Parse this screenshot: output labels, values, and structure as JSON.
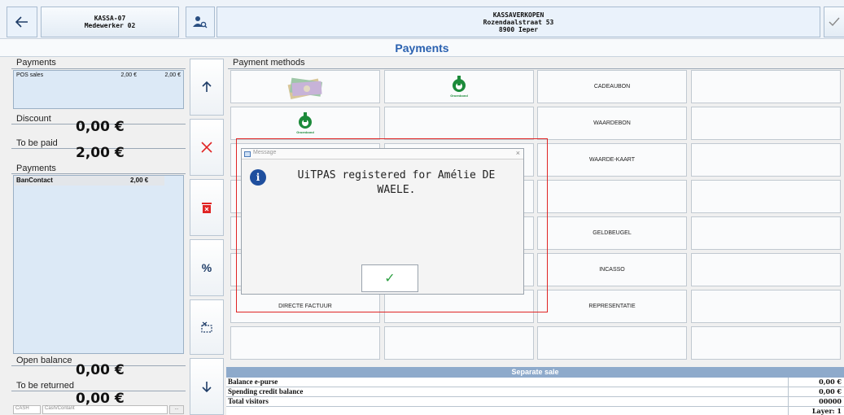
{
  "header": {
    "register": "KASSA-07",
    "employee": "Medewerker 02",
    "shop_name": "KASSAVERKOPEN",
    "shop_street": "Rozendaalstraat 53",
    "shop_city": "8900 Ieper"
  },
  "title": "Payments",
  "left": {
    "payments_label": "Payments",
    "pos_sales_label": "POS sales",
    "pos_sales_v1": "2,00 €",
    "pos_sales_v2": "2,00 €",
    "discount_label": "Discount",
    "discount_value": "0,00 €",
    "to_be_paid_label": "To be paid",
    "to_be_paid_value": "2,00 €",
    "payments2_label": "Payments",
    "bancontact_label": "BanContact",
    "bancontact_value": "2,00 €",
    "open_balance_label": "Open balance",
    "open_balance_value": "0,00 €",
    "to_be_returned_label": "To be returned",
    "to_be_returned_value": "0,00 €",
    "cash_label": "CASH",
    "cash_field": "Cash/Contant",
    "more_btn": "..."
  },
  "payment_methods_label": "Payment methods",
  "grid": {
    "cadeaubon": "CADEAUBON",
    "waardebon": "WAARDEBON",
    "waardekaart": "WAARDE-KAART",
    "geldbeugel": "GELDBEUGEL",
    "incasso": "INCASSO",
    "directe_factuur": "DIRECTE FACTUUR",
    "representatie": "REPRESENTATIE",
    "groenbond_1": "Groenbond",
    "groenbond_2": "Groenbond"
  },
  "dialog": {
    "title": "Message",
    "close": "×",
    "message_line1": "UiTPAS registered for Amélie DE",
    "message_line2": "WAELE.",
    "info_glyph": "i",
    "ok_glyph": "✓"
  },
  "bottom": {
    "header": "Separate sale",
    "rows": [
      {
        "label": "Balance e-purse",
        "value": "0,00 €"
      },
      {
        "label": "Spending credit balance",
        "value": "0,00 €"
      },
      {
        "label": "Total visitors",
        "value": "00000"
      }
    ],
    "layer": "Layer: 1"
  },
  "colors": {
    "accent": "#2a61b0",
    "danger": "#e02424",
    "groen": "#1c8a3a",
    "ok": "#2ea043"
  },
  "icons": {
    "back": "arrow-left-icon",
    "user_search": "user-search-icon",
    "confirm": "check-icon",
    "up": "arrow-up-icon",
    "cancel": "x-icon",
    "delete": "trash-icon",
    "percent": "percent-icon",
    "split": "split-icon",
    "down": "arrow-down-icon"
  }
}
